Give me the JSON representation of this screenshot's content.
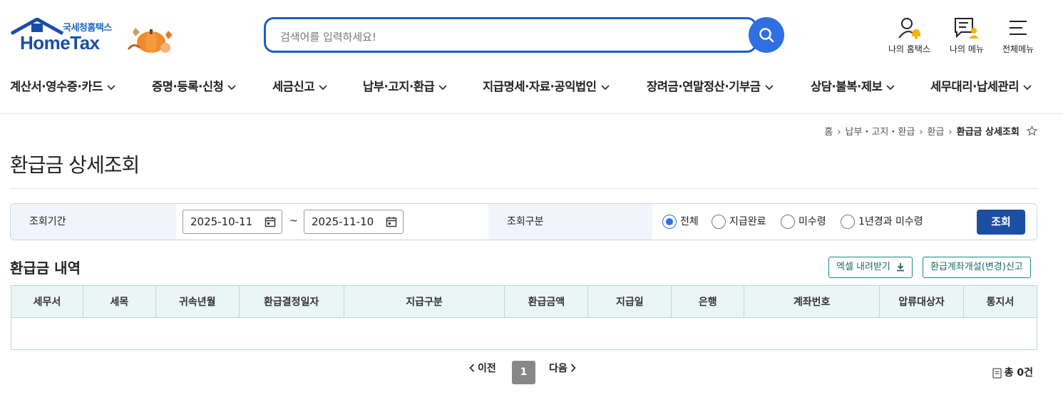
{
  "logo": {
    "ko": "국세청홈택스",
    "en": "HomeTax"
  },
  "search": {
    "placeholder": "검색어를 입력하세요!"
  },
  "util": {
    "my_hometax": "나의 홈택스",
    "my_menu": "나의 메뉴",
    "all_menu": "전체메뉴"
  },
  "gnb": [
    "계산서·영수증·카드",
    "증명·등록·신청",
    "세금신고",
    "납부·고지·환급",
    "지급명세·자료·공익법인",
    "장려금·연말정산·기부금",
    "상담·불복·제보",
    "세무대리·납세관리"
  ],
  "breadcrumb": {
    "home": "홈",
    "l1": "납부・고지・환급",
    "l2": "환급",
    "current": "환급금 상세조회"
  },
  "page_title": "환급금 상세조회",
  "filter": {
    "period_label": "조회기간",
    "date_from": "2025-10-11",
    "tilde": "~",
    "date_to": "2025-11-10",
    "type_label": "조회구분",
    "options": [
      "전체",
      "지급완료",
      "미수령",
      "1년경과 미수령"
    ],
    "selected": "전체",
    "query_button": "조회"
  },
  "section": {
    "title": "환급금 내역",
    "excel_button": "엑셀 내려받기",
    "account_button": "환급계좌개설(변경)신고"
  },
  "table": {
    "columns": [
      "세무서",
      "세목",
      "귀속년월",
      "환급결정일자",
      "지급구분",
      "환급금액",
      "지급일",
      "은행",
      "계좌번호",
      "압류대상자",
      "통지서"
    ],
    "rows": []
  },
  "pager": {
    "prev": "이전",
    "page": "1",
    "next": "다음",
    "total": "총 0건"
  },
  "colors": {
    "primary": "#1c4fa3",
    "search_border": "#1e5ec8",
    "table_header_bg": "#eaf6f4",
    "accent_teal": "#1b8b86"
  }
}
